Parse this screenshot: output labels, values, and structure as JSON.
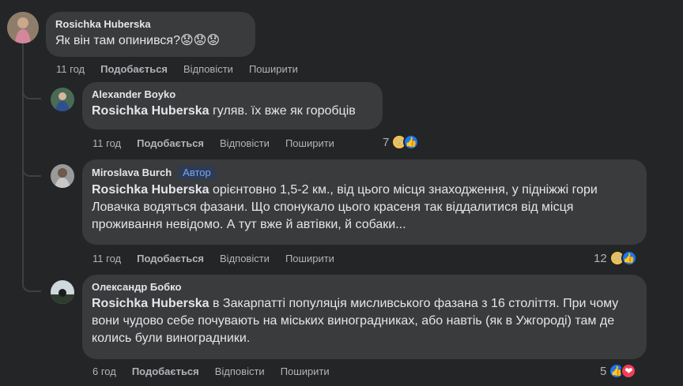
{
  "comments": [
    {
      "author": "Rosichka Huberska",
      "text": "Як він там опинився?",
      "emoji": "😟😟😟",
      "time": "11 год",
      "like": "Подобається",
      "reply": "Відповісти",
      "share": "Поширити"
    },
    {
      "author": "Alexander Boyko",
      "mention": "Rosichka Huberska",
      "text": " гуляв. їх вже як горобців",
      "time": "11 год",
      "like": "Подобається",
      "reply": "Відповісти",
      "share": "Поширити",
      "reaction_count": "7",
      "reactions": [
        "wow-icon",
        "like-icon"
      ]
    },
    {
      "author": "Miroslava Burch",
      "badge": "Автор",
      "mention": "Rosichka Huberska",
      "text": " орієнтовно 1,5-2 км., від цього місця знаходження, у підніжжі гори Ловачка водяться фазани. Що спонукало цього красеня так віддалитися від місця проживання невідомо. А тут вже й автівки, й собаки...",
      "time": "11 год",
      "like": "Подобається",
      "reply": "Відповісти",
      "share": "Поширити",
      "reaction_count": "12",
      "reactions": [
        "sad-icon",
        "like-icon"
      ]
    },
    {
      "author": "Олександр Бобко",
      "mention": "Rosichka Huberska",
      "text": " в Закарпатті популяція мисливського фазана з 16 століття. При чому вони чудово себе почувають на міських виноградниках, або навтіь (як в Ужгороді) там де колись були виноградники.",
      "time": "6 год",
      "like": "Подобається",
      "reply": "Відповісти",
      "share": "Поширити",
      "reaction_count": "5",
      "reactions": [
        "like-icon",
        "love-icon"
      ]
    }
  ],
  "colors": {
    "background": "#242526",
    "bubble": "#3a3b3c",
    "text": "#e4e6eb",
    "secondary": "#b0b3b8",
    "like": "#1877f2",
    "love": "#f33e58",
    "badge_text": "#7aa7f5"
  }
}
